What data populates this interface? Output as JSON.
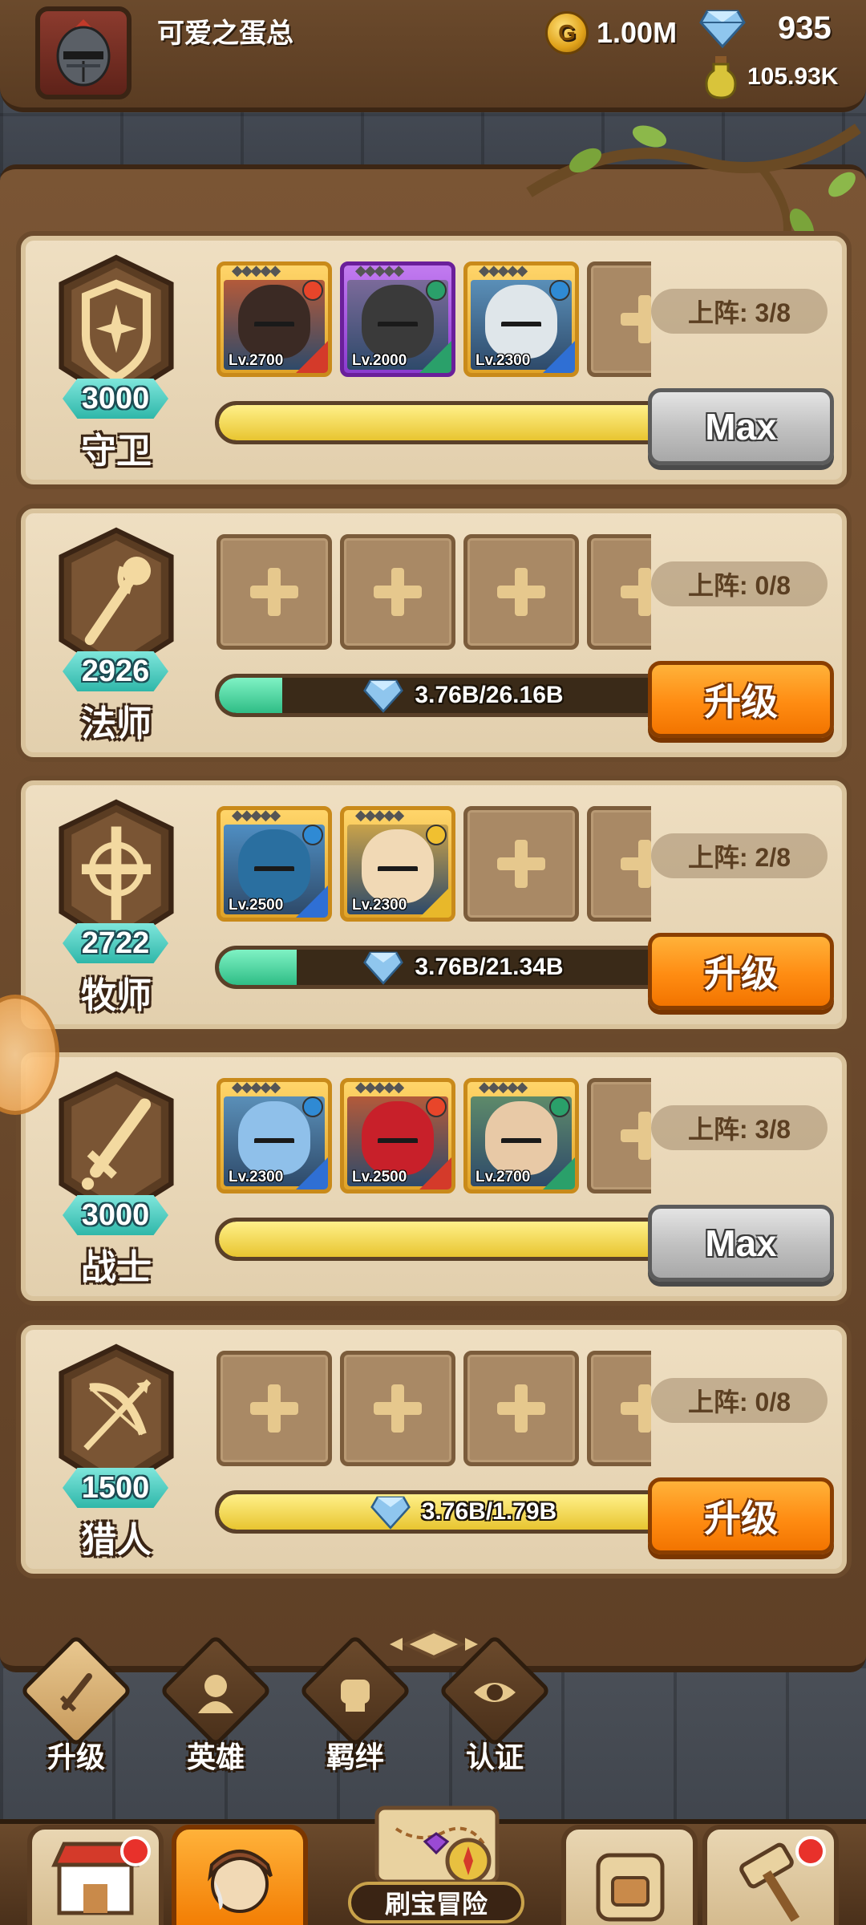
{
  "header": {
    "player_name": "可爱之蛋总",
    "gold": "1.00M",
    "gems": "935",
    "potions": "105.93K",
    "icons": [
      "knight-avatar",
      "gold-coin-icon",
      "gem-icon",
      "potion-icon"
    ]
  },
  "classes": [
    {
      "name": "守卫",
      "level": "3000",
      "icon": "shield-icon",
      "deploy": "上阵: 3/8",
      "action": "Max",
      "action_type": "max",
      "progress_fraction": 1.0,
      "progress_color": "yellow",
      "progress_text": "",
      "heroes": [
        {
          "lv": "Lv.2700",
          "frame": "gold",
          "element": "fire",
          "role_color": "#d43a2a",
          "skin": "#3b2a24",
          "bg": "#b35a3a"
        },
        {
          "lv": "Lv.2000",
          "frame": "purple",
          "element": "wind",
          "role_color": "#2aa06a",
          "skin": "#3a3a3a",
          "bg": "#7b6a9a"
        },
        {
          "lv": "Lv.2300",
          "frame": "gold",
          "element": "water",
          "role_color": "#2f6fd4",
          "skin": "#dfe6ea",
          "bg": "#5a8fb8"
        }
      ],
      "empty_slots": 1
    },
    {
      "name": "法师",
      "level": "2926",
      "icon": "staff-icon",
      "deploy": "上阵: 0/8",
      "action": "升级",
      "action_type": "upgrade",
      "progress_fraction": 0.1437,
      "progress_color": "green",
      "progress_text": "3.76B/26.16B",
      "heroes": [],
      "empty_slots": 4
    },
    {
      "name": "牧师",
      "level": "2722",
      "icon": "holy-cross-icon",
      "deploy": "上阵: 2/8",
      "action": "升级",
      "action_type": "upgrade",
      "progress_fraction": 0.1762,
      "progress_color": "green",
      "progress_text": "3.76B/21.34B",
      "heroes": [
        {
          "lv": "Lv.2500",
          "frame": "gold",
          "element": "water",
          "role_color": "#2f6fd4",
          "skin": "#2a6fa0",
          "bg": "#4f8ec2"
        },
        {
          "lv": "Lv.2300",
          "frame": "gold",
          "element": "light",
          "role_color": "#e8b82a",
          "skin": "#f1d9b5",
          "bg": "#c9a24a"
        }
      ],
      "empty_slots": 2
    },
    {
      "name": "战士",
      "level": "3000",
      "icon": "sword-icon",
      "deploy": "上阵: 3/8",
      "action": "Max",
      "action_type": "max",
      "progress_fraction": 1.0,
      "progress_color": "yellow",
      "progress_text": "",
      "heroes": [
        {
          "lv": "Lv.2300",
          "frame": "gold",
          "element": "water",
          "role_color": "#2f6fd4",
          "skin": "#8fc0ea",
          "bg": "#5a8fb8"
        },
        {
          "lv": "Lv.2500",
          "frame": "gold",
          "element": "fire",
          "role_color": "#d43a2a",
          "skin": "#c8202a",
          "bg": "#b35a3a"
        },
        {
          "lv": "Lv.2700",
          "frame": "gold",
          "element": "wind",
          "role_color": "#2aa06a",
          "skin": "#e8c9a6",
          "bg": "#5e8a6a"
        }
      ],
      "empty_slots": 1
    },
    {
      "name": "猎人",
      "level": "1500",
      "icon": "bow-icon",
      "deploy": "上阵: 0/8",
      "action": "升级",
      "action_type": "upgrade",
      "progress_fraction": 1.0,
      "progress_color": "yellow",
      "progress_text": "3.76B/1.79B",
      "heroes": [],
      "empty_slots": 4
    }
  ],
  "sub_tabs": [
    {
      "label": "升级",
      "icon": "upgrade-sword-icon",
      "active": true
    },
    {
      "label": "英雄",
      "icon": "hero-icon",
      "active": false
    },
    {
      "label": "羁绊",
      "icon": "fist-bond-icon",
      "active": false
    },
    {
      "label": "认证",
      "icon": "eye-certify-icon",
      "active": false
    }
  ],
  "bottom_nav": {
    "adventure_label": "刷宝冒险",
    "items": [
      {
        "icon": "shop-icon",
        "active": false,
        "badge": true
      },
      {
        "icon": "hero-portrait-icon",
        "active": true,
        "badge": false
      },
      {
        "icon": "map-icon",
        "active": false,
        "badge": false
      },
      {
        "icon": "backpack-icon",
        "active": false,
        "badge": false
      },
      {
        "icon": "forge-hammer-icon",
        "active": false,
        "badge": true
      }
    ]
  },
  "colors": {
    "panel": "#e9d6b2",
    "frame_brown": "#6b4a2c",
    "upgrade_orange": "#ff8c12",
    "max_grey": "#c2c2c2",
    "level_teal": "#2fb7a9"
  }
}
